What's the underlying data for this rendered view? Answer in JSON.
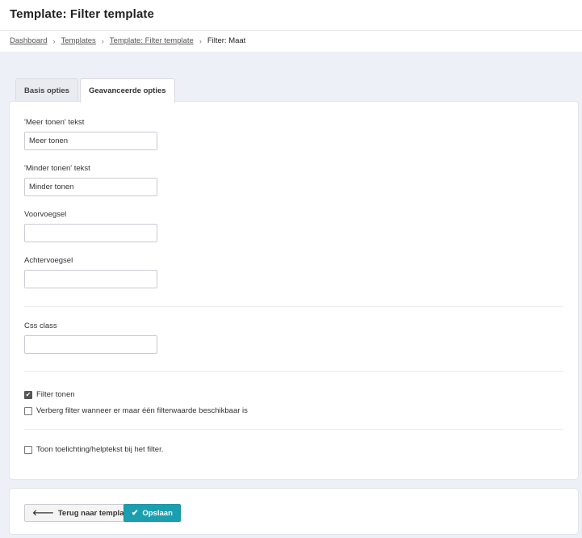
{
  "header": {
    "title": "Template: Filter template"
  },
  "breadcrumb": {
    "items": [
      "Dashboard",
      "Templates",
      "Template: Filter template"
    ],
    "current": "Filter: Maat",
    "separator": "›"
  },
  "tabs": [
    {
      "label": "Basis opties",
      "active": false
    },
    {
      "label": "Geavanceerde opties",
      "active": true
    }
  ],
  "form": {
    "meer_tonen": {
      "label": "'Meer tonen' tekst",
      "value": "Meer tonen"
    },
    "minder_tonen": {
      "label": "'Minder tonen' tekst",
      "value": "Minder tonen"
    },
    "voorvoegsel": {
      "label": "Voorvoegsel",
      "value": ""
    },
    "achtervoegsel": {
      "label": "Achtervoegsel",
      "value": ""
    },
    "css_class": {
      "label": "Css class",
      "value": ""
    },
    "filter_tonen": {
      "label": "Filter tonen",
      "checked": true
    },
    "verberg_filter": {
      "label": "Verberg filter wanneer er maar één filterwaarde beschikbaar is",
      "checked": false
    },
    "toon_toelichting": {
      "label": "Toon toelichting/helptekst bij het filter.",
      "checked": false
    }
  },
  "footer": {
    "back_label": "Terug naar template",
    "save_label": "Opslaan",
    "back_icon": "arrow-left-icon",
    "save_icon": "checkmark-icon"
  },
  "colors": {
    "primary": "#1a9fb0",
    "background": "#eef0f7"
  }
}
